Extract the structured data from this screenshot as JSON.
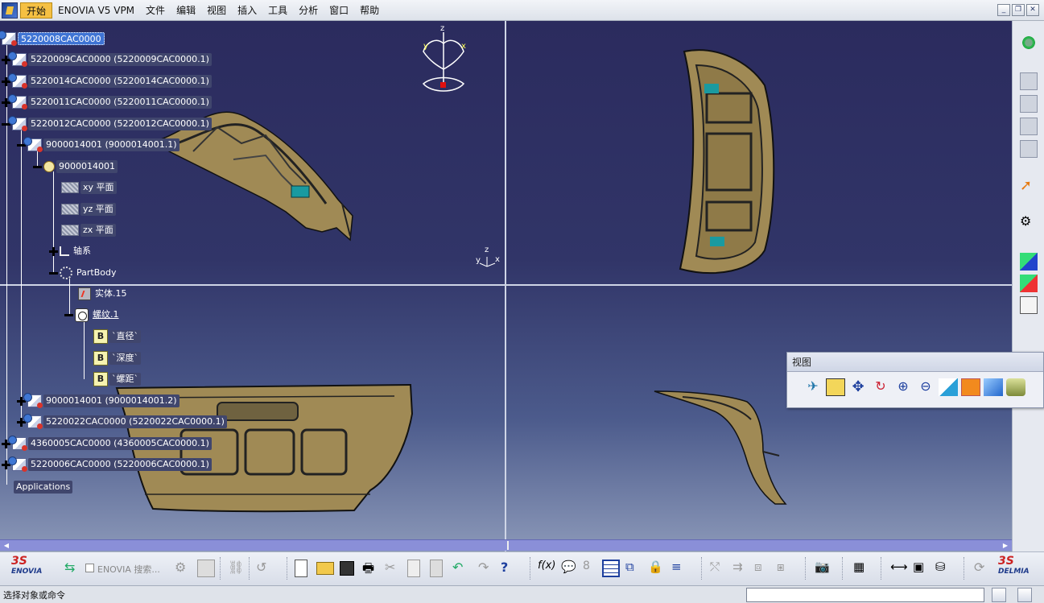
{
  "menubar": {
    "items": [
      "开始",
      "ENOVIA V5 VPM",
      "文件",
      "编辑",
      "视图",
      "插入",
      "工具",
      "分析",
      "窗口",
      "帮助"
    ]
  },
  "tree": {
    "nodes": [
      {
        "label": "5220008CAC0000"
      },
      {
        "label": "5220009CAC0000 (5220009CAC0000.1)"
      },
      {
        "label": "5220014CAC0000 (5220014CAC0000.1)"
      },
      {
        "label": "5220011CAC0000 (5220011CAC0000.1)"
      },
      {
        "label": "5220012CAC0000 (5220012CAC0000.1)"
      },
      {
        "label": "9000014001 (9000014001.1)"
      },
      {
        "label": "9000014001"
      },
      {
        "label": "xy 平面"
      },
      {
        "label": "yz 平面"
      },
      {
        "label": "zx 平面"
      },
      {
        "label": "轴系"
      },
      {
        "label": "PartBody"
      },
      {
        "label": "实体.15"
      },
      {
        "label": "螺纹.1"
      },
      {
        "label": "`直径`"
      },
      {
        "label": "`深度`"
      },
      {
        "label": "`螺距`"
      },
      {
        "label": "9000014001 (9000014001.2)"
      },
      {
        "label": "5220022CAC0000 (5220022CAC0000.1)"
      },
      {
        "label": "4360005CAC0000 (4360005CAC0000.1)"
      },
      {
        "label": "5220006CAC0000 (5220006CAC0000.1)"
      },
      {
        "label": "Applications"
      }
    ]
  },
  "compass": {
    "z": "z",
    "x": "x",
    "y": "y"
  },
  "axis_triad": {
    "z": "z",
    "x": "x",
    "y": "y"
  },
  "palette": {
    "title": "视图"
  },
  "bottom_toolbar": {
    "enovia_search": "ENOVIA 搜索...",
    "enovia_logo": "ENOVIA",
    "delmia_logo": "DELMIA"
  },
  "statusbar": {
    "text": "选择对象或命令"
  }
}
